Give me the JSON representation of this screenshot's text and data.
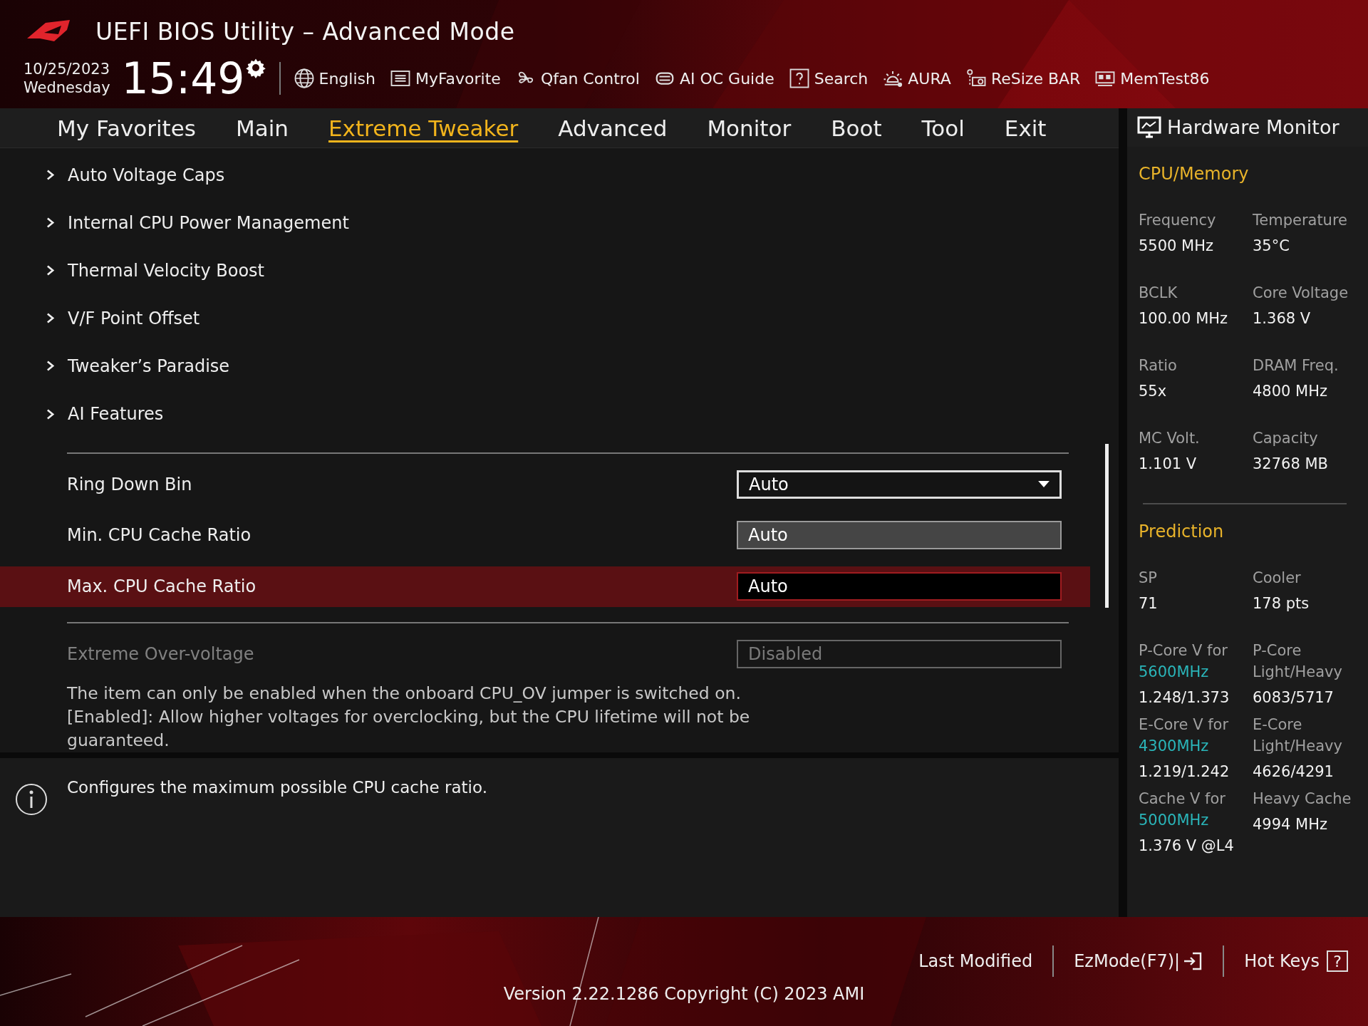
{
  "header": {
    "title": "UEFI BIOS Utility – Advanced Mode",
    "date": "10/25/2023",
    "day": "Wednesday",
    "time": "15:49",
    "tools": [
      {
        "label": "English"
      },
      {
        "label": "MyFavorite"
      },
      {
        "label": "Qfan Control"
      },
      {
        "label": "AI OC Guide"
      },
      {
        "label": "Search"
      },
      {
        "label": "AURA"
      },
      {
        "label": "ReSize BAR"
      },
      {
        "label": "MemTest86"
      }
    ]
  },
  "tabs": [
    {
      "label": "My Favorites",
      "selected": false
    },
    {
      "label": "Main",
      "selected": false
    },
    {
      "label": "Extreme Tweaker",
      "selected": true
    },
    {
      "label": "Advanced",
      "selected": false
    },
    {
      "label": "Monitor",
      "selected": false
    },
    {
      "label": "Boot",
      "selected": false
    },
    {
      "label": "Tool",
      "selected": false
    },
    {
      "label": "Exit",
      "selected": false
    }
  ],
  "submenus": [
    "Auto Voltage Caps",
    "Internal CPU Power Management",
    "Thermal Velocity Boost",
    "V/F Point Offset",
    "Tweaker’s Paradise",
    "AI Features"
  ],
  "settings": [
    {
      "label": "Ring Down Bin",
      "value": "Auto",
      "kind": "dropdown",
      "selected": false,
      "disabled": false
    },
    {
      "label": "Min. CPU Cache Ratio",
      "value": "Auto",
      "kind": "field",
      "selected": false,
      "disabled": false
    },
    {
      "label": "Max. CPU Cache Ratio",
      "value": "Auto",
      "kind": "field",
      "selected": true,
      "disabled": false
    }
  ],
  "extra_setting": {
    "label": "Extreme Over-voltage",
    "value": "Disabled",
    "kind": "dropdown",
    "selected": false,
    "disabled": true
  },
  "extra_description": "The item can only be enabled when the onboard CPU_OV jumper is switched on. [Enabled]: Allow higher voltages for overclocking, but the CPU lifetime will not be guaranteed.",
  "help_text": "Configures the maximum possible CPU cache ratio.",
  "hardware_monitor": {
    "title": "Hardware Monitor",
    "sections": [
      {
        "title": "CPU/Memory",
        "rows": [
          [
            {
              "label": "Frequency",
              "value": "5500 MHz"
            },
            {
              "label": "Temperature",
              "value": "35°C"
            }
          ],
          [
            {
              "label": "BCLK",
              "value": "100.00 MHz"
            },
            {
              "label": "Core Voltage",
              "value": "1.368 V"
            }
          ],
          [
            {
              "label": "Ratio",
              "value": "55x"
            },
            {
              "label": "DRAM Freq.",
              "value": "4800 MHz"
            }
          ],
          [
            {
              "label": "MC Volt.",
              "value": "1.101 V"
            },
            {
              "label": "Capacity",
              "value": "32768 MB"
            }
          ]
        ]
      },
      {
        "title": "Prediction",
        "rows": [
          [
            {
              "label": "SP",
              "value": "71"
            },
            {
              "label": "Cooler",
              "value": "178 pts"
            }
          ],
          [
            {
              "label": "P-Core V for",
              "accent": "5600MHz",
              "value": "1.248/1.373"
            },
            {
              "label": "P-Core Light/Heavy",
              "value": "6083/5717"
            }
          ],
          [
            {
              "label": "E-Core V for",
              "accent": "4300MHz",
              "value": "1.219/1.242"
            },
            {
              "label": "E-Core Light/Heavy",
              "value": "4626/4291"
            }
          ],
          [
            {
              "label": "Cache V for",
              "accent": "5000MHz",
              "value": "1.376 V @L4"
            },
            {
              "label": "Heavy Cache",
              "value": "4994 MHz"
            }
          ]
        ]
      }
    ]
  },
  "footer": {
    "buttons": [
      {
        "label": "Last Modified"
      },
      {
        "label": "EzMode(F7)|"
      },
      {
        "label": "Hot Keys",
        "key": "?"
      }
    ],
    "version": "Version 2.22.1286 Copyright (C) 2023 AMI"
  }
}
